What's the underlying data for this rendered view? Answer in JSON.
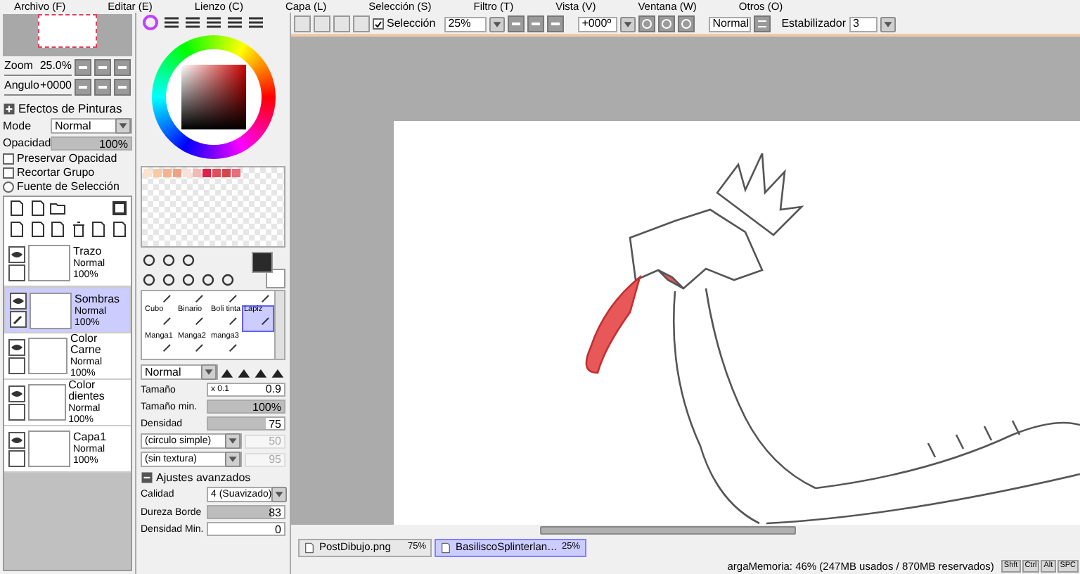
{
  "menu": [
    "Archivo (F)",
    "Editar (E)",
    "Lienzo (C)",
    "Capa (L)",
    "Selección (S)",
    "Filtro (T)",
    "Vista (V)",
    "Ventana (W)",
    "Otros (O)"
  ],
  "navigator": {
    "zoom_label": "Zoom",
    "zoom_value": "25.0%",
    "angle_label": "Angulo",
    "angle_value": "+0000"
  },
  "effects": {
    "label": "Efectos de Pinturas",
    "mode_label": "Mode",
    "mode_value": "Normal",
    "opacity_label": "Opacidad",
    "opacity_value": "100%",
    "level": 1
  },
  "options": [
    {
      "kind": "checkbox",
      "label": "Preservar Opacidad",
      "checked": false
    },
    {
      "kind": "checkbox",
      "label": "Recortar Grupo",
      "checked": false
    },
    {
      "kind": "radio",
      "label": "Fuente de Selección",
      "checked": false
    }
  ],
  "layers": [
    {
      "name": "Trazo",
      "mode": "Normal",
      "opacity": "100%",
      "selected": false,
      "visible": true
    },
    {
      "name": "Sombras",
      "mode": "Normal",
      "opacity": "100%",
      "selected": true,
      "visible": true
    },
    {
      "name": "Color Carne",
      "mode": "Normal",
      "opacity": "100%",
      "selected": false,
      "visible": true
    },
    {
      "name": "Color dientes",
      "mode": "Normal",
      "opacity": "100%",
      "selected": false,
      "visible": true
    },
    {
      "name": "Capa1",
      "mode": "Normal",
      "opacity": "100%",
      "selected": false,
      "visible": true
    }
  ],
  "swatches": [
    {
      "color": "#fde3cf"
    },
    {
      "color": "#f9c9a6"
    },
    {
      "color": "#f5b48e"
    },
    {
      "color": "#f0a283"
    },
    {
      "color": "#fbe0dc"
    },
    {
      "color": "#f4b9b4"
    },
    {
      "color": "#e0204a"
    },
    {
      "color": "#e04e5a"
    },
    {
      "color": "#d6444d"
    },
    {
      "color": "#e86d7d"
    }
  ],
  "brushes": [
    [
      {
        "selected": false
      },
      {
        "selected": false
      },
      {
        "selected": false
      },
      {
        "selected": false
      }
    ],
    [
      {
        "label": "Cubo",
        "selected": false
      },
      {
        "label": "Binario",
        "selected": false
      },
      {
        "label": "Boli tinta",
        "selected": false
      },
      {
        "label": "Lapiz",
        "selected": true
      }
    ],
    [
      {
        "label": "Manga1",
        "selected": false
      },
      {
        "label": "Manga2",
        "selected": false
      },
      {
        "label": "manga3",
        "selected": false
      }
    ]
  ],
  "brush": {
    "blend": "Normal",
    "size_label": "Tamaño",
    "size_multiplier": "x 0.1",
    "size_value": "0.9",
    "min_size": {
      "label": "Tamaño min.",
      "value": "100%",
      "level": 1
    },
    "density": {
      "label": "Densidad",
      "value": "75",
      "level": 0.75
    },
    "shape": "(circulo simple)",
    "shape_value": "50",
    "texture": "(sin textura)",
    "texture_value": "95",
    "advanced_label": "Ajustes avanzados",
    "quality_label": "Calidad",
    "quality_value": "4 (Suavizado)",
    "hardness": {
      "label": "Dureza Borde",
      "value": "83",
      "level": 0.83
    },
    "min_density": {
      "label": "Densidad Min.",
      "value": "0",
      "level": 0
    }
  },
  "toolbar": {
    "selection_label": "Selección",
    "selection_checked": true,
    "zoom": "25%",
    "angle": "+000º",
    "blend": "Normal",
    "stabilizer_label": "Estabilizador",
    "stabilizer_value": "3"
  },
  "tabs": [
    {
      "name": "PostDibujo.png",
      "zoom": "75%",
      "selected": false
    },
    {
      "name": "BasiliscoSplinterlan…",
      "zoom": "25%",
      "selected": true
    }
  ],
  "status_bar": {
    "text": "argaMemoria: 46% (247MB usados / 870MB reservados)",
    "keys": [
      "Shft",
      "Ctrl",
      "Alt",
      "SPC"
    ]
  }
}
